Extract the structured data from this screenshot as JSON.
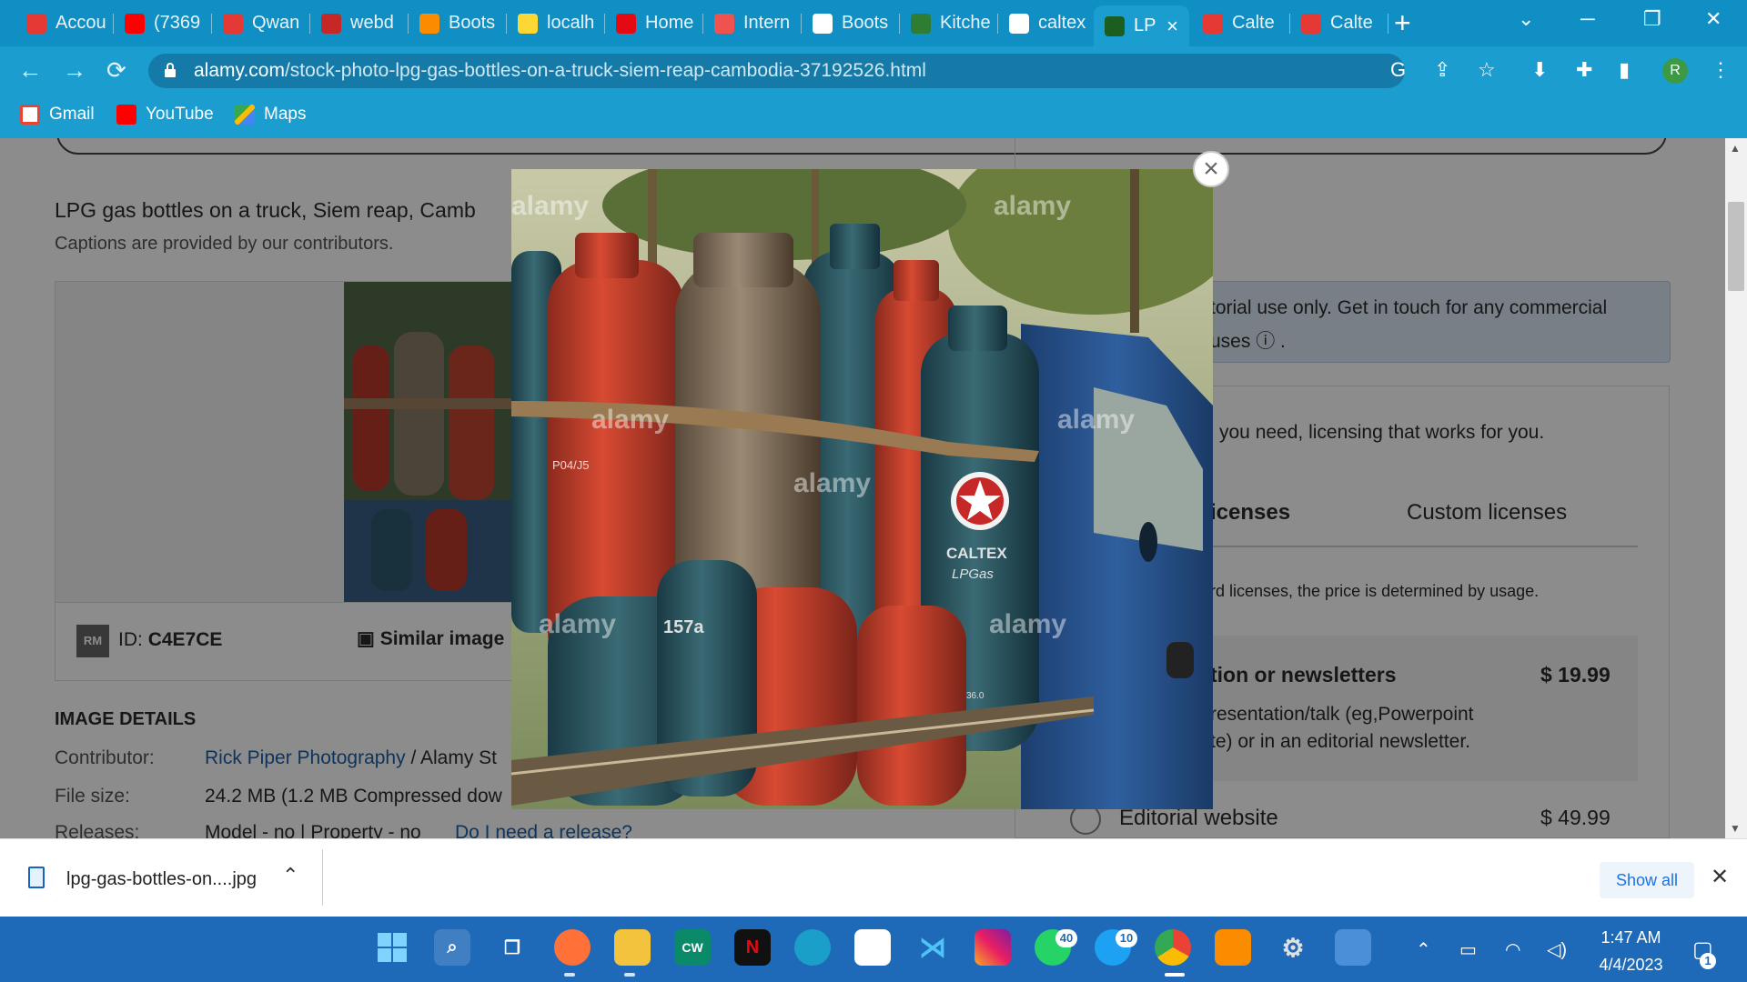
{
  "colors": {
    "tabstrip": "#0f8fc4",
    "toolbar": "#1b9dd0",
    "taskbar": "#1f6ab8",
    "link": "#1a73e8"
  },
  "tabs": [
    {
      "label": "Accou",
      "icon": "k-icon",
      "color": "#e53935"
    },
    {
      "label": "(7369",
      "icon": "youtube-icon",
      "color": "#ff0000"
    },
    {
      "label": "Qwan",
      "icon": "qwant-icon",
      "color": "#e53935"
    },
    {
      "label": "webd",
      "icon": "webd-icon",
      "color": "#c62828"
    },
    {
      "label": "Boots",
      "icon": "bootstrap-icon",
      "color": "#fb8c00"
    },
    {
      "label": "localh",
      "icon": "localhost-icon",
      "color": "#fdd835"
    },
    {
      "label": "Home",
      "icon": "netflix-icon",
      "color": "#e50914"
    },
    {
      "label": "Intern",
      "icon": "speed-icon",
      "color": "#ef5350"
    },
    {
      "label": "Boots",
      "icon": "globe-icon",
      "color": "#ffffff"
    },
    {
      "label": "Kitche",
      "icon": "jiji-icon",
      "color": "#2e7d32"
    },
    {
      "label": "caltex",
      "icon": "google-icon",
      "color": "#ffffff"
    },
    {
      "label": "LP",
      "icon": "alamy-icon",
      "color": "#1b5e20",
      "active": true
    },
    {
      "label": "Calte",
      "icon": "caltex-icon",
      "color": "#e53935"
    },
    {
      "label": "Calte",
      "icon": "caltex-icon",
      "color": "#e53935"
    }
  ],
  "address": {
    "domain": "alamy.com",
    "path": "/stock-photo-lpg-gas-bottles-on-a-truck-siem-reap-cambodia-37192526.html"
  },
  "bookmarks": [
    {
      "label": "Gmail",
      "icon": "gmail-icon"
    },
    {
      "label": "YouTube",
      "icon": "youtube-icon"
    },
    {
      "label": "Maps",
      "icon": "maps-icon"
    }
  ],
  "page": {
    "caption": "LPG gas bottles on a truck, Siem reap, Camb",
    "caption_note": "Captions are provided by our contributors.",
    "rm_badge": "RM",
    "id_label": "ID:",
    "id_value": "C4E7CE",
    "similar": "Similar image",
    "details_heading": "IMAGE DETAILS",
    "contributor_label": "Contributor:",
    "contributor_value": "Rick Piper Photography",
    "contributor_suffix": " / Alamy St",
    "filesize_label": "File size:",
    "filesize_value": "24.2 MB (1.2 MB Compressed dow",
    "releases_label": "Releases:",
    "releases_value": "Model - no  |  Property - no",
    "release_link": "Do I need a release?",
    "editorial_note_1": "torial use only. Get in touch for any commercial",
    "editorial_note_2": "uses ⓘ .",
    "licensing_tagline": "you need, licensing that works for you.",
    "tab_licenses": "icenses",
    "tab_custom": "Custom licenses",
    "usage_note": "rd licenses, the price is determined by usage.",
    "option1_title": "tion or newsletters",
    "option1_price": "$ 19.99",
    "option1_desc_1": "resentation/talk (eg,Powerpoint",
    "option1_desc_2": "te) or in an editorial newsletter.",
    "option2_title": "Editorial website",
    "option2_price": "$ 49.99"
  },
  "modal": {
    "close": "×",
    "watermark": "alamy",
    "label_tank": "P04/J5",
    "label_num": "157a",
    "brand": "CALTEX",
    "brand_sub": "LPGas",
    "tank_code": "36.0"
  },
  "download": {
    "filename": "lpg-gas-bottles-on....jpg",
    "show_all": "Show all"
  },
  "taskbar": {
    "badges": {
      "whatsapp": "40",
      "twitter": "10"
    },
    "time": "1:47 AM",
    "date": "4/4/2023",
    "notif": "1"
  }
}
